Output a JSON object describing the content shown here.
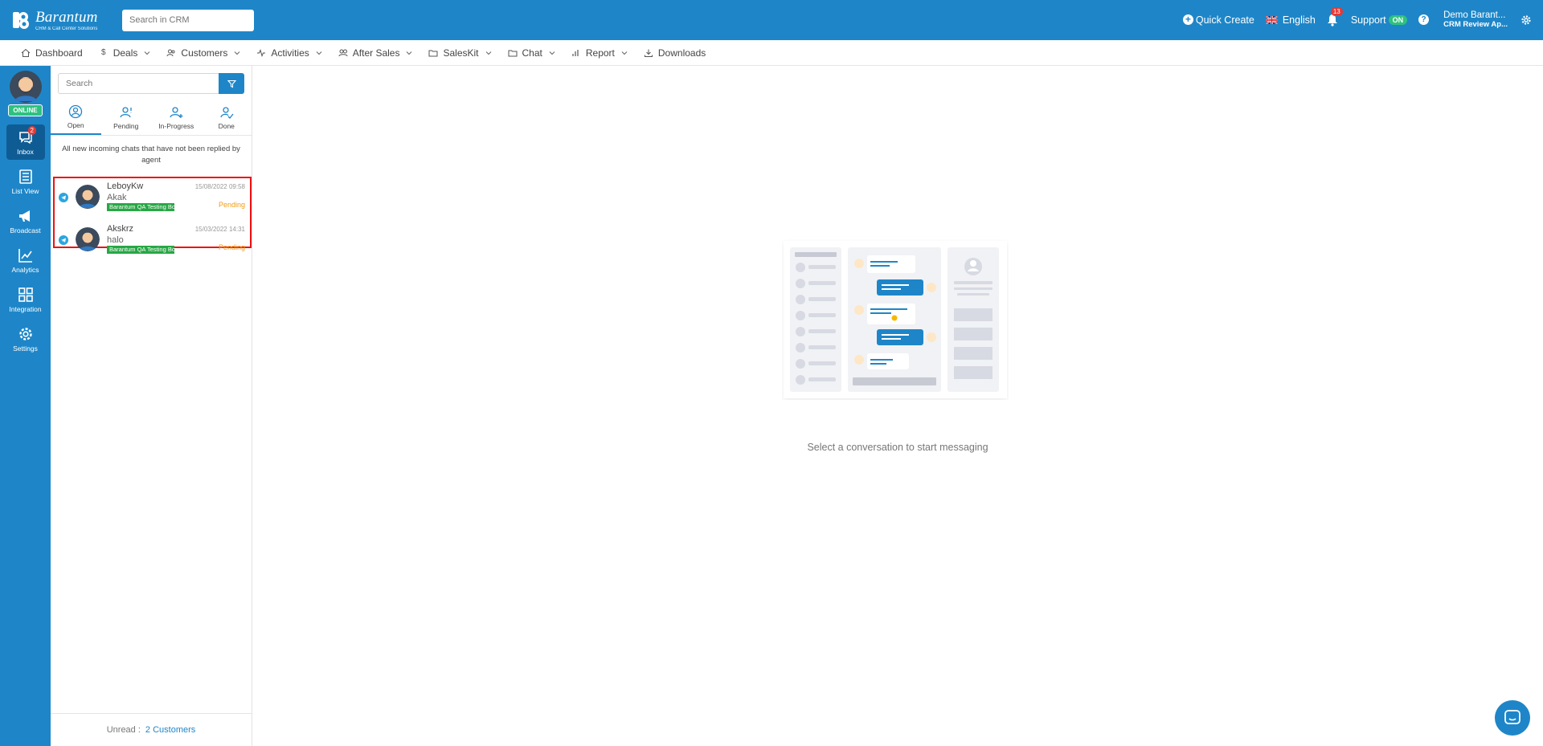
{
  "brand": {
    "name": "Barantum",
    "tagline": "CRM & Call Center Solutions"
  },
  "topbar": {
    "search_placeholder": "Search in CRM",
    "quick_create": "Quick Create",
    "language": "English",
    "notification_count": "13",
    "support_label": "Support",
    "support_status": "ON",
    "user_name": "Demo Barant...",
    "user_company": "CRM Review Ap..."
  },
  "nav": {
    "items": [
      {
        "label": "Dashboard",
        "icon": "home-icon"
      },
      {
        "label": "Deals",
        "icon": "dollar-icon"
      },
      {
        "label": "Customers",
        "icon": "users-icon"
      },
      {
        "label": "Activities",
        "icon": "activity-icon"
      },
      {
        "label": "After Sales",
        "icon": "after-sales-icon"
      },
      {
        "label": "SalesKit",
        "icon": "folder-icon"
      },
      {
        "label": "Chat",
        "icon": "folder-icon"
      },
      {
        "label": "Report",
        "icon": "chart-icon"
      },
      {
        "label": "Downloads",
        "icon": "download-icon"
      }
    ]
  },
  "sidebar": {
    "status": "ONLINE",
    "items": [
      {
        "label": "Inbox",
        "badge": "2",
        "icon": "inbox-icon"
      },
      {
        "label": "List View",
        "icon": "list-icon"
      },
      {
        "label": "Broadcast",
        "icon": "megaphone-icon"
      },
      {
        "label": "Analytics",
        "icon": "analytics-icon"
      },
      {
        "label": "Integration",
        "icon": "grid-icon"
      },
      {
        "label": "Settings",
        "icon": "gear-icon"
      }
    ]
  },
  "chatpanel": {
    "search_placeholder": "Search",
    "tabs": [
      {
        "label": "Open"
      },
      {
        "label": "Pending"
      },
      {
        "label": "In-Progress"
      },
      {
        "label": "Done"
      }
    ],
    "description": "All new incoming chats that have not been replied by agent",
    "chats": [
      {
        "name": "LeboyKw",
        "time": "15/08/2022 09:58",
        "message": "Akak",
        "tag": "Barantum QA Testing Bo",
        "status": "Pending"
      },
      {
        "name": "Akskrz",
        "time": "15/03/2022 14:31",
        "message": "halo",
        "tag": "Barantum QA Testing Bo",
        "status": "Pending"
      }
    ],
    "unread_label": "Unread :",
    "unread_count": "2 Customers"
  },
  "main": {
    "empty_text": "Select a conversation to start messaging"
  },
  "colors": {
    "primary": "#1e86c8",
    "online": "#2ec27e",
    "pending": "#f39c12",
    "tag": "#28a745",
    "highlight": "#ee1111"
  }
}
